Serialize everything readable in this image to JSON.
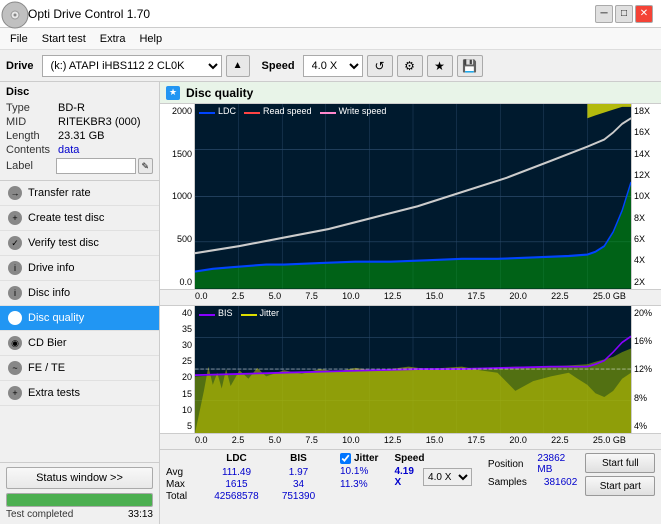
{
  "titleBar": {
    "title": "Opti Drive Control 1.70",
    "minBtn": "─",
    "maxBtn": "□",
    "closeBtn": "✕"
  },
  "menuBar": {
    "items": [
      "File",
      "Start test",
      "Extra",
      "Help"
    ]
  },
  "toolbar": {
    "driveLabel": "Drive",
    "driveValue": "(k:)  ATAPI iHBS112  2 CL0K",
    "speedLabel": "Speed",
    "speedValue": "4.0 X"
  },
  "disc": {
    "title": "Disc",
    "typeLabel": "Type",
    "typeValue": "BD-R",
    "midLabel": "MID",
    "midValue": "RITEKBR3 (000)",
    "lengthLabel": "Length",
    "lengthValue": "23.31 GB",
    "contentsLabel": "Contents",
    "contentsValue": "data",
    "labelLabel": "Label",
    "labelValue": ""
  },
  "navItems": [
    {
      "id": "transfer-rate",
      "label": "Transfer rate",
      "active": false
    },
    {
      "id": "create-test-disc",
      "label": "Create test disc",
      "active": false
    },
    {
      "id": "verify-test-disc",
      "label": "Verify test disc",
      "active": false
    },
    {
      "id": "drive-info",
      "label": "Drive info",
      "active": false
    },
    {
      "id": "disc-info",
      "label": "Disc info",
      "active": false
    },
    {
      "id": "disc-quality",
      "label": "Disc quality",
      "active": true
    },
    {
      "id": "cd-bier",
      "label": "CD Bier",
      "active": false
    },
    {
      "id": "fe-te",
      "label": "FE / TE",
      "active": false
    },
    {
      "id": "extra-tests",
      "label": "Extra tests",
      "active": false
    }
  ],
  "statusWindow": {
    "btnLabel": "Status window >>",
    "progress": 100,
    "statusText": "Test completed",
    "timeText": "33:13"
  },
  "chartHeader": {
    "title": "Disc quality"
  },
  "chart1": {
    "legendItems": [
      {
        "label": "LDC",
        "color": "#0044ff"
      },
      {
        "label": "Read speed",
        "color": "#ff4444"
      },
      {
        "label": "Write speed",
        "color": "#ff88cc"
      }
    ],
    "yAxisLeft": [
      "2000",
      "1500",
      "1000",
      "500",
      "0.0"
    ],
    "yAxisRight": [
      "18X",
      "16X",
      "14X",
      "12X",
      "10X",
      "8X",
      "6X",
      "4X",
      "2X"
    ],
    "xAxis": [
      "0.0",
      "2.5",
      "5.0",
      "7.5",
      "10.0",
      "12.5",
      "15.0",
      "17.5",
      "20.0",
      "22.5",
      "25.0 GB"
    ]
  },
  "chart2": {
    "legendItems": [
      {
        "label": "BIS",
        "color": "#8800ff"
      },
      {
        "label": "Jitter",
        "color": "#dddd00"
      }
    ],
    "yAxisLeft": [
      "40",
      "35",
      "30",
      "25",
      "20",
      "15",
      "10",
      "5"
    ],
    "yAxisRight": [
      "20%",
      "16%",
      "12%",
      "8%",
      "4%"
    ],
    "xAxis": [
      "0.0",
      "2.5",
      "5.0",
      "7.5",
      "10.0",
      "12.5",
      "15.0",
      "17.5",
      "20.0",
      "22.5",
      "25.0 GB"
    ]
  },
  "stats": {
    "ldcLabel": "LDC",
    "bisLabel": "BIS",
    "jitterLabel": "Jitter",
    "speedLabel": "Speed",
    "avgLabel": "Avg",
    "maxLabel": "Max",
    "totalLabel": "Total",
    "ldcAvg": "111.49",
    "ldcMax": "1615",
    "ldcTotal": "42568578",
    "bisAvg": "1.97",
    "bisMax": "34",
    "bisTotal": "751390",
    "jitterAvg": "10.1%",
    "jitterMax": "11.3%",
    "speedCurrent": "4.19 X",
    "speedSelect": "4.0 X",
    "positionLabel": "Position",
    "positionVal": "23862 MB",
    "samplesLabel": "Samples",
    "samplesVal": "381602",
    "startFullLabel": "Start full",
    "startPartLabel": "Start part"
  }
}
